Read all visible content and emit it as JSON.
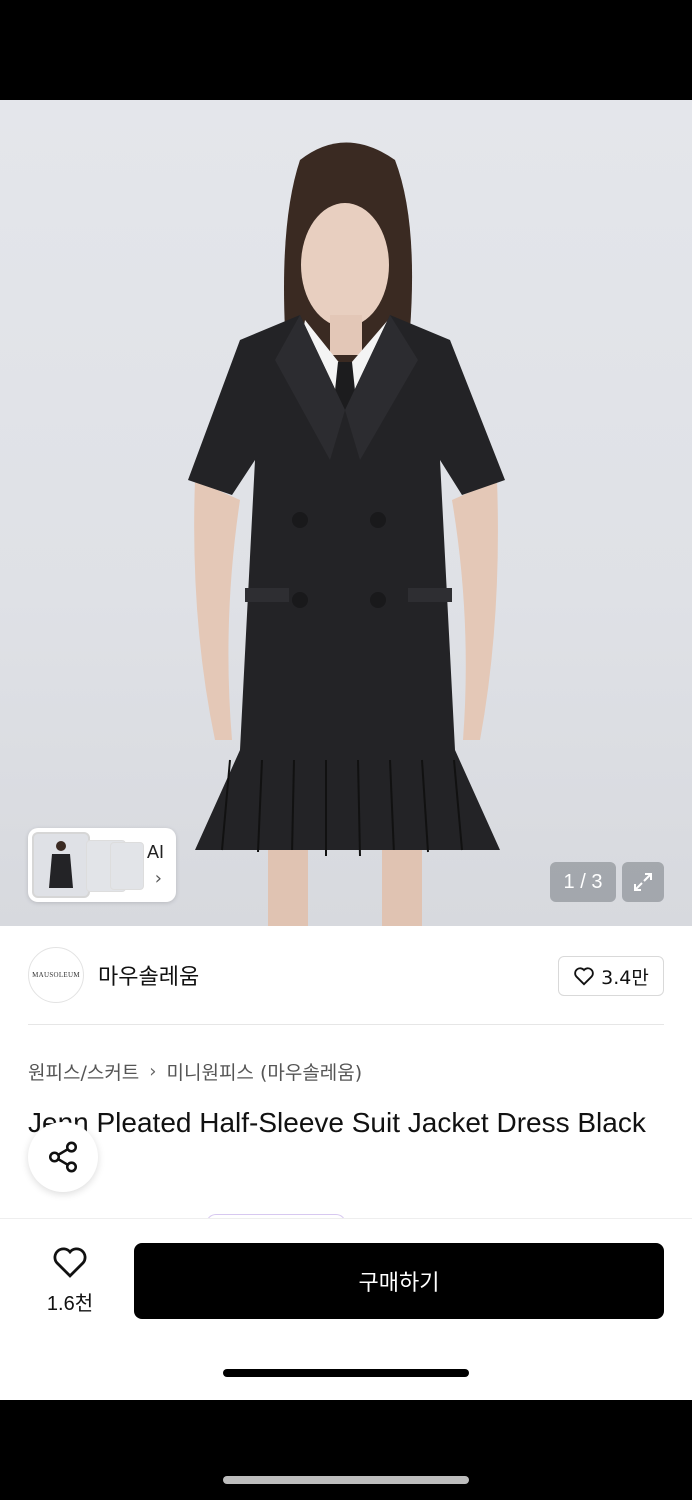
{
  "gallery": {
    "counter": "1 / 3",
    "ai_label": "AI",
    "ai_chevron": "›"
  },
  "brand": {
    "logo_text": "MAUSOLEUM",
    "name": "마우솔레움",
    "like_count": "3.4만"
  },
  "breadcrumb": {
    "category": "원피스/스커트",
    "separator": "›",
    "subcategory": "미니원피스 (마우솔레움)"
  },
  "product": {
    "title": "Jenn Pleated Half-Sleeve Suit Jacket Dress Black"
  },
  "actions": {
    "favorite_count": "1.6천",
    "buy_label": "구매하기"
  },
  "colors": {
    "buy_button": "#000000",
    "hero_bg": "#e1e3e8"
  }
}
